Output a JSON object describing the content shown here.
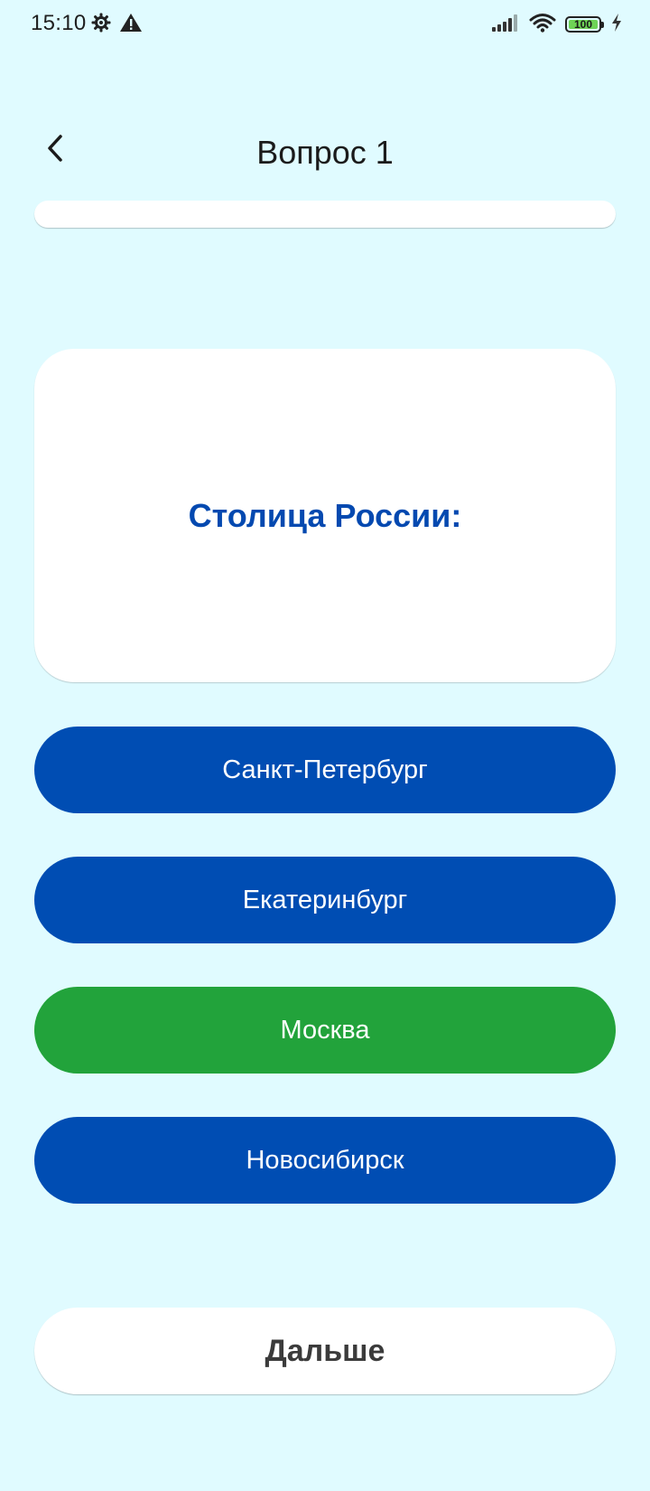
{
  "status_bar": {
    "time": "15:10",
    "left_icons": [
      "gear-icon",
      "warning-icon"
    ],
    "right_icons": [
      "signal-icon",
      "wifi-icon",
      "battery-icon",
      "charging-icon"
    ],
    "battery_level": "100"
  },
  "header": {
    "title": "Вопрос 1"
  },
  "question": {
    "text": "Столица России:"
  },
  "answers": [
    {
      "label": "Санкт-Петербург",
      "state": "default"
    },
    {
      "label": "Екатеринбург",
      "state": "default"
    },
    {
      "label": "Москва",
      "state": "correct"
    },
    {
      "label": "Новосибирск",
      "state": "default"
    }
  ],
  "next_button": {
    "label": "Дальше"
  },
  "colors": {
    "background": "#e0fbff",
    "answer_default": "#004db3",
    "answer_correct": "#22a33b",
    "question_text": "#0449b0",
    "battery_fill": "#6ed356"
  }
}
